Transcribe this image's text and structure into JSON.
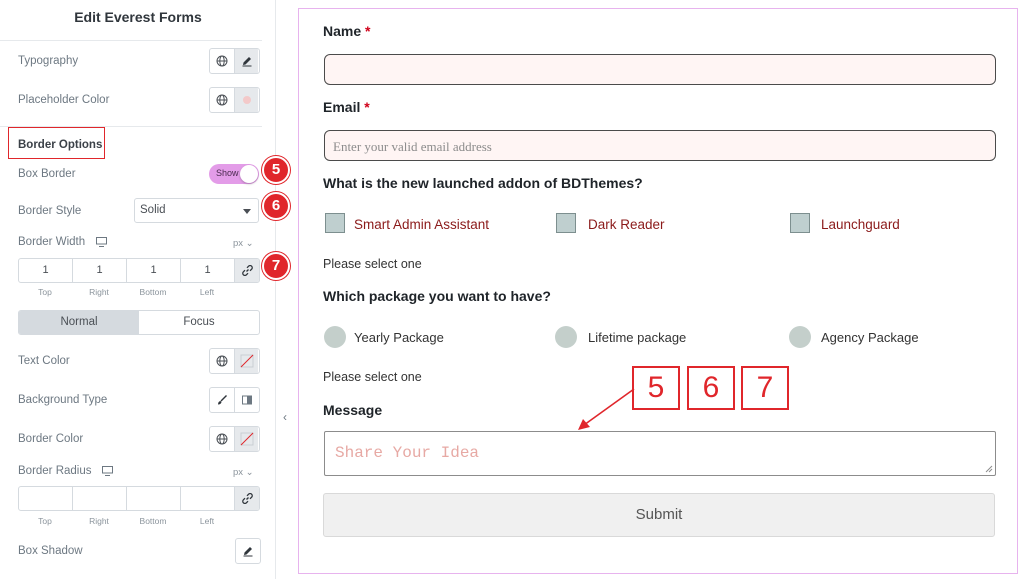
{
  "panel": {
    "title": "Edit Everest Forms",
    "typography_label": "Typography",
    "placeholder_color_label": "Placeholder Color",
    "border_options_label": "Border Options",
    "box_border_label": "Box Border",
    "box_border_toggle": "Show",
    "border_style_label": "Border Style",
    "border_style_value": "Solid",
    "border_width_label": "Border Width",
    "unit": "px",
    "border_width_values": [
      "1",
      "1",
      "1",
      "1"
    ],
    "dim_labels": [
      "Top",
      "Right",
      "Bottom",
      "Left"
    ],
    "tabs": [
      "Normal",
      "Focus"
    ],
    "text_color_label": "Text Color",
    "background_type_label": "Background Type",
    "border_color_label": "Border Color",
    "border_radius_label": "Border Radius",
    "box_shadow_label": "Box Shadow"
  },
  "form": {
    "name_label": "Name",
    "email_label": "Email",
    "required_mark": "*",
    "email_placeholder": "Enter your valid email address",
    "question1": "What is the new launched addon of BDThemes?",
    "checkbox_options": [
      "Smart Admin Assistant",
      "Dark Reader",
      "Launchguard"
    ],
    "select_one_1": "Please select one",
    "question2": "Which package you want to have?",
    "radio_options": [
      "Yearly Package",
      "Lifetime package",
      "Agency Package"
    ],
    "select_one_2": "Please select one",
    "message_label": "Message",
    "message_placeholder": "Share Your Idea",
    "submit_label": "Submit"
  },
  "annotations": {
    "badges": [
      "5",
      "6",
      "7"
    ],
    "boxes": [
      "5",
      "6",
      "7"
    ]
  },
  "colors": {
    "accent_red": "#e0262b",
    "toggle_on": "#e39ce8",
    "form_border": "#e7b3ee",
    "checkbox_label": "#8b1a1a",
    "input_bg": "#fff5f4"
  }
}
